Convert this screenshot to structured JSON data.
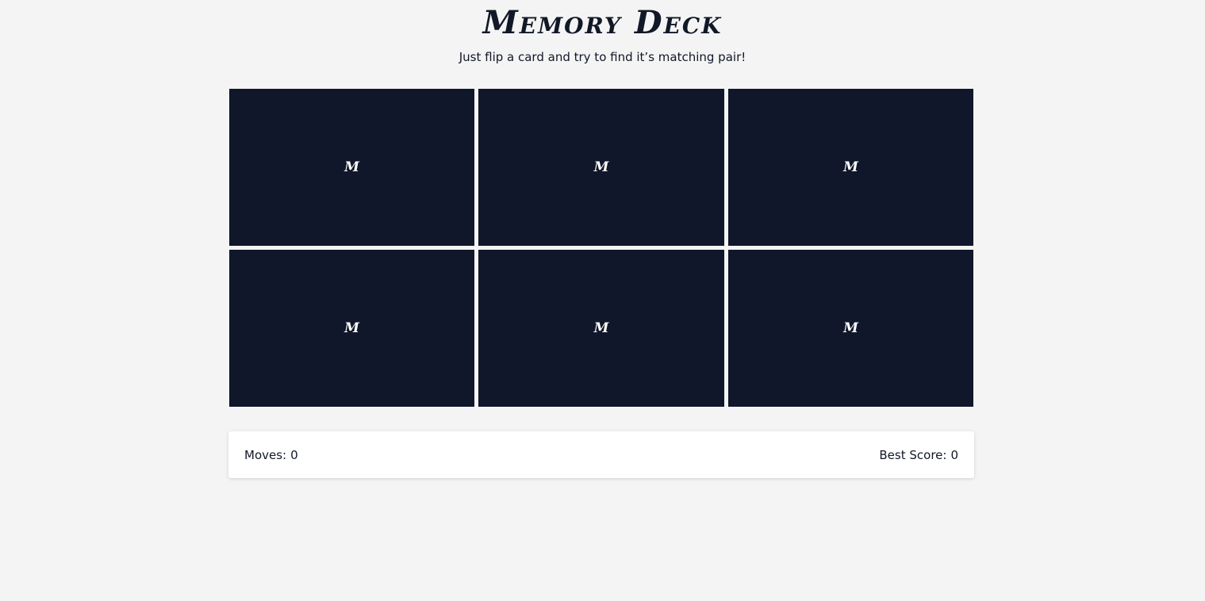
{
  "header": {
    "title": "Memory Deck",
    "subtitle": "Just flip a card and try to find it’s matching pair!"
  },
  "board": {
    "cards": [
      {
        "face": "M"
      },
      {
        "face": "M"
      },
      {
        "face": "M"
      },
      {
        "face": "M"
      },
      {
        "face": "M"
      },
      {
        "face": "M"
      }
    ]
  },
  "score": {
    "moves_label": "Moves:",
    "moves_value": "0",
    "best_label": "Best Score:",
    "best_value": "0"
  },
  "colors": {
    "background": "#f4f4f4",
    "card_back": "#10172b",
    "text": "#111827",
    "panel": "#ffffff"
  }
}
